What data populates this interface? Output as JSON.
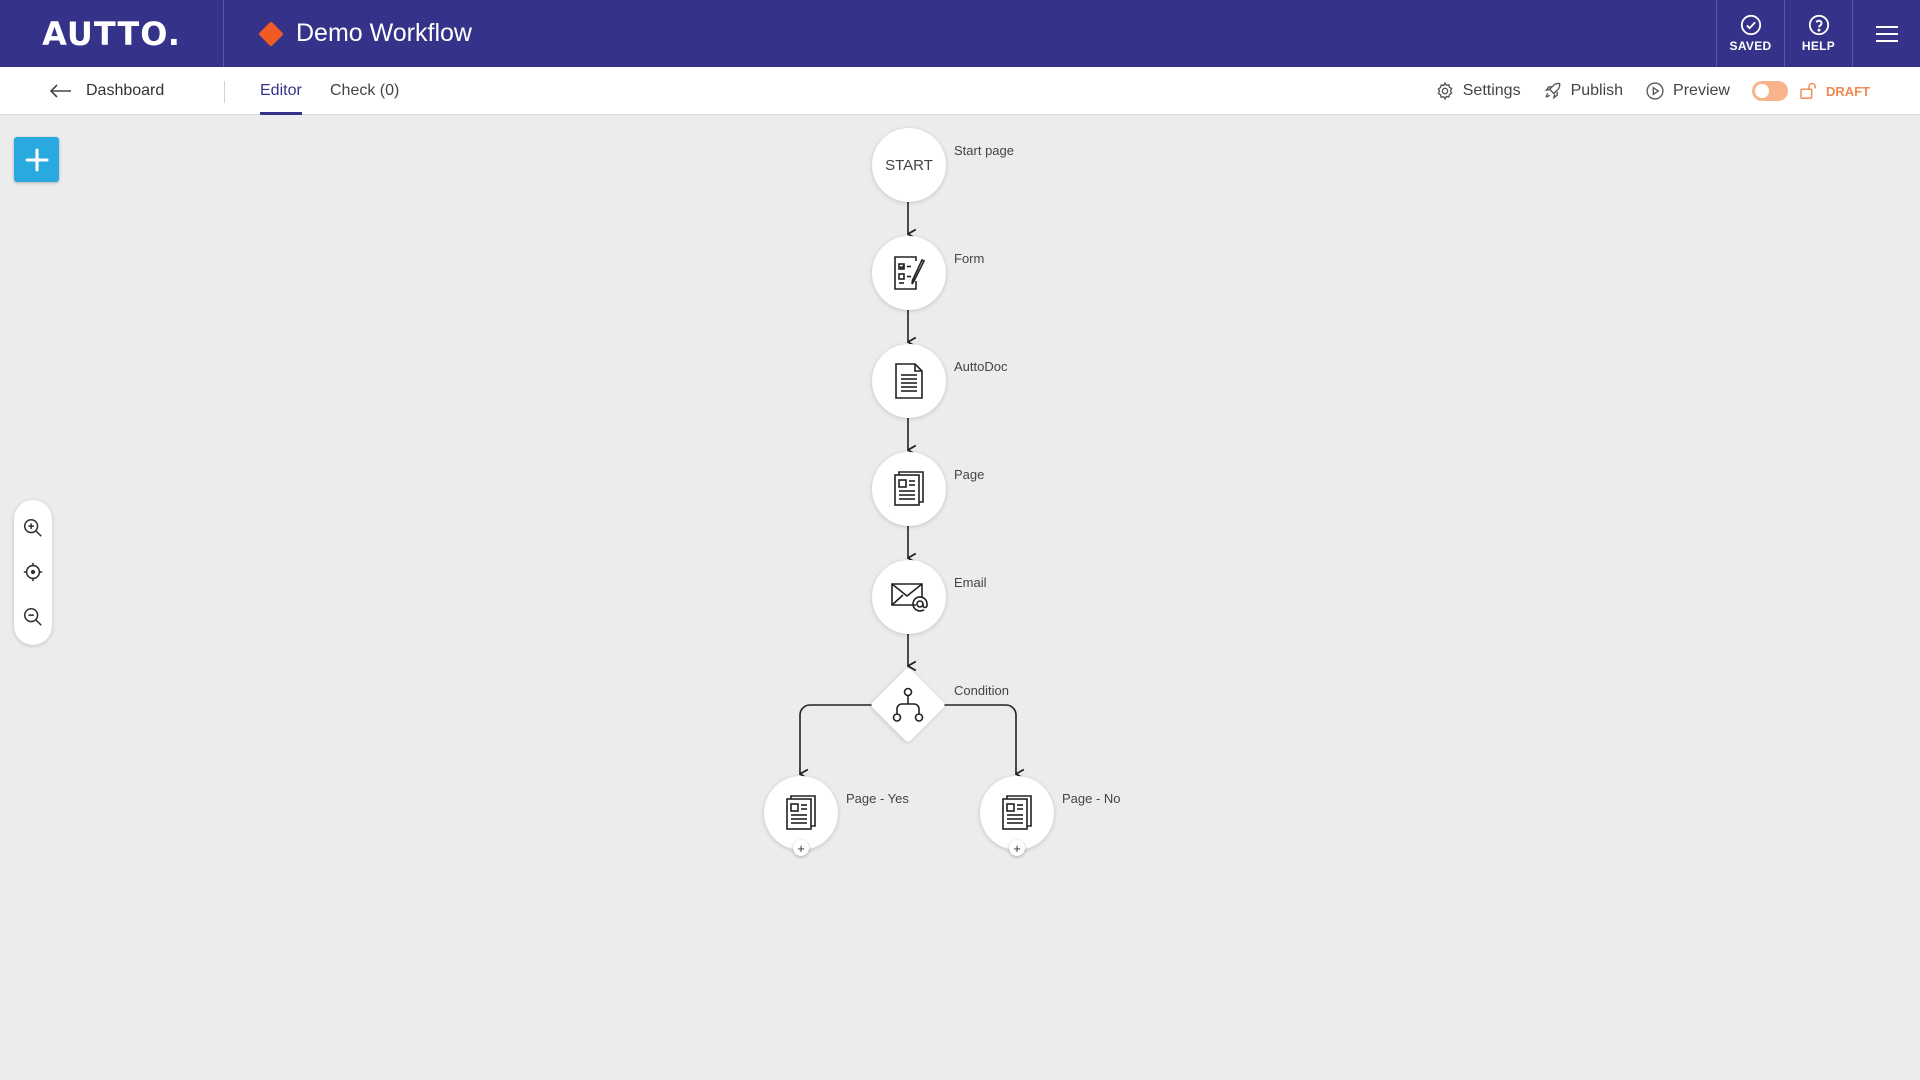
{
  "app": {
    "logo": "AUTTO.",
    "workflow_title": "Demo Workflow",
    "title_color": "#f05a24",
    "brand_color": "#353389",
    "accent_color": "#2aa9e0"
  },
  "top_actions": {
    "saved_label": "SAVED",
    "help_label": "HELP"
  },
  "subnav": {
    "back_label": "Dashboard",
    "tabs": [
      {
        "label": "Editor",
        "active": true
      },
      {
        "label": "Check (0)",
        "active": false
      }
    ],
    "settings_label": "Settings",
    "publish_label": "Publish",
    "preview_label": "Preview",
    "status_label": "DRAFT"
  },
  "workflow": {
    "nodes": [
      {
        "type": "start",
        "text": "START",
        "label": "Start page"
      },
      {
        "type": "form",
        "label": "Form"
      },
      {
        "type": "autodoc",
        "label": "AuttoDoc"
      },
      {
        "type": "page",
        "label": "Page"
      },
      {
        "type": "email",
        "label": "Email"
      },
      {
        "type": "condition",
        "label": "Condition"
      },
      {
        "type": "page",
        "label": "Page - Yes"
      },
      {
        "type": "page",
        "label": "Page - No"
      }
    ],
    "add_step_symbol": "+"
  }
}
